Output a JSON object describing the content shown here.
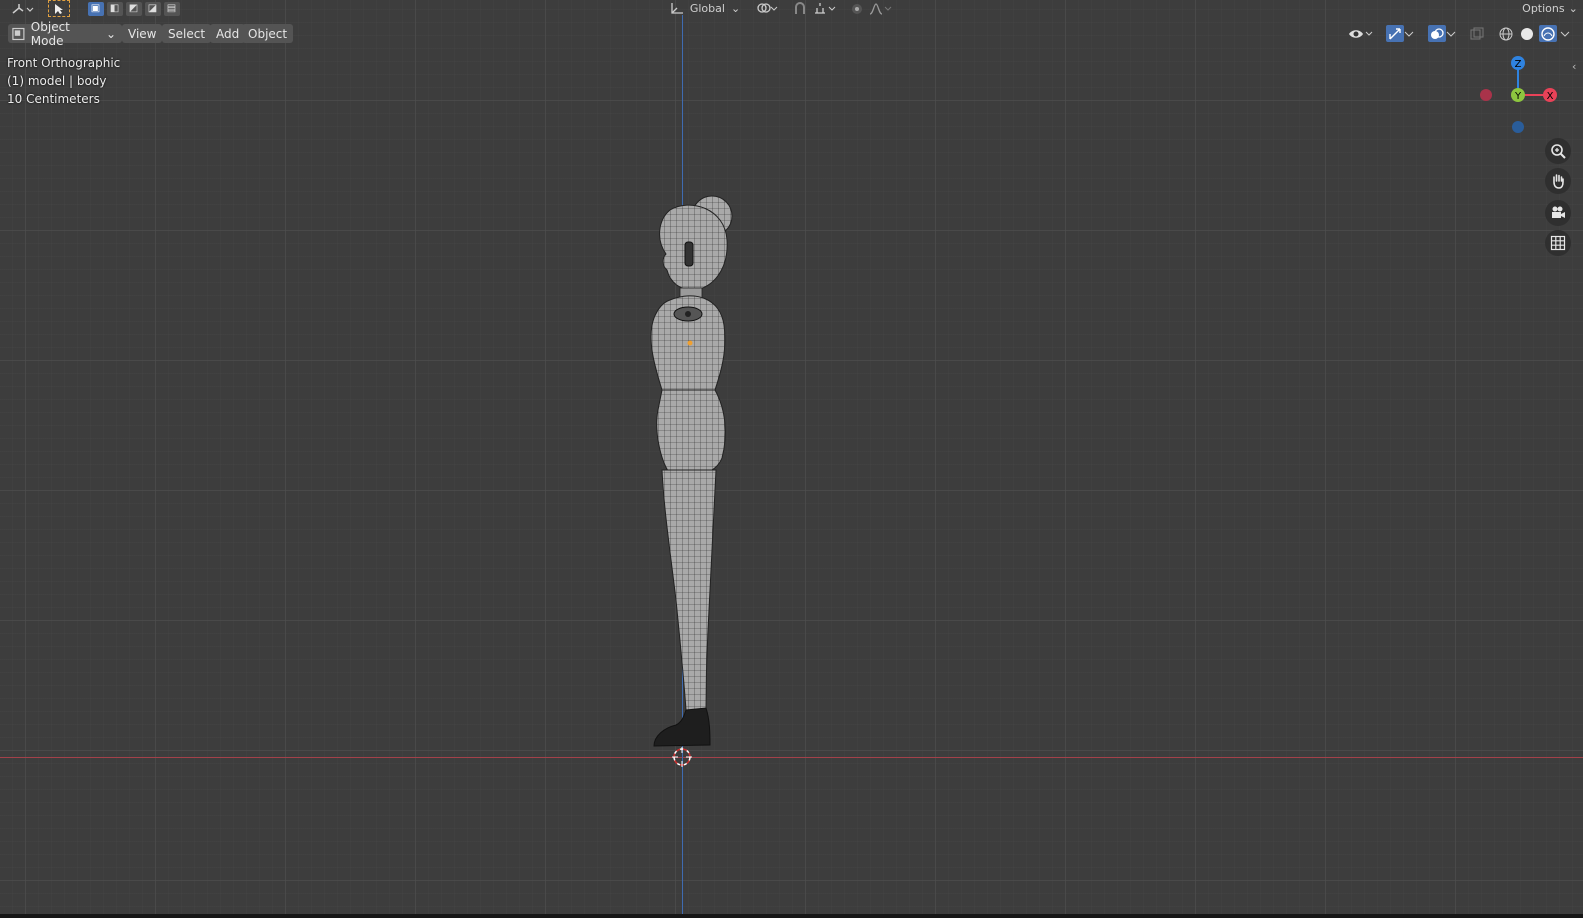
{
  "topbar": {
    "editor_type_icon": "orientation-gizmo-icon",
    "select_tool_icon": "cursor-select-icon",
    "select_modes": [
      "box-new",
      "box-extend",
      "box-subtract",
      "box-invert",
      "box-intersect"
    ],
    "orientation_label": "Global",
    "options_label": "Options"
  },
  "header": {
    "mode_label": "Object Mode",
    "menus": [
      "View",
      "Select",
      "Add",
      "Object"
    ]
  },
  "overlay": {
    "view_name": "Front Orthographic",
    "object_info": "(1) model | body",
    "scale_info": "10 Centimeters"
  },
  "gizmo": {
    "z_label": "Z",
    "y_label": "Y",
    "x_label": "X",
    "colors": {
      "x": "#e94258",
      "y": "#8dc63f",
      "z": "#2f83e0",
      "neg_x": "#a9334a",
      "neg_z": "#2a5d9a"
    }
  },
  "nav_buttons": [
    "zoom-icon",
    "pan-hand-icon",
    "camera-icon",
    "grid-toggle-icon"
  ],
  "colors": {
    "accent": "#4772b3",
    "background": "#3d3d3d",
    "x_axis_line": "#a3414a",
    "z_axis_line": "#3f6bb0",
    "mesh": "#a9a9a9",
    "wire": "#2a2a2a"
  }
}
